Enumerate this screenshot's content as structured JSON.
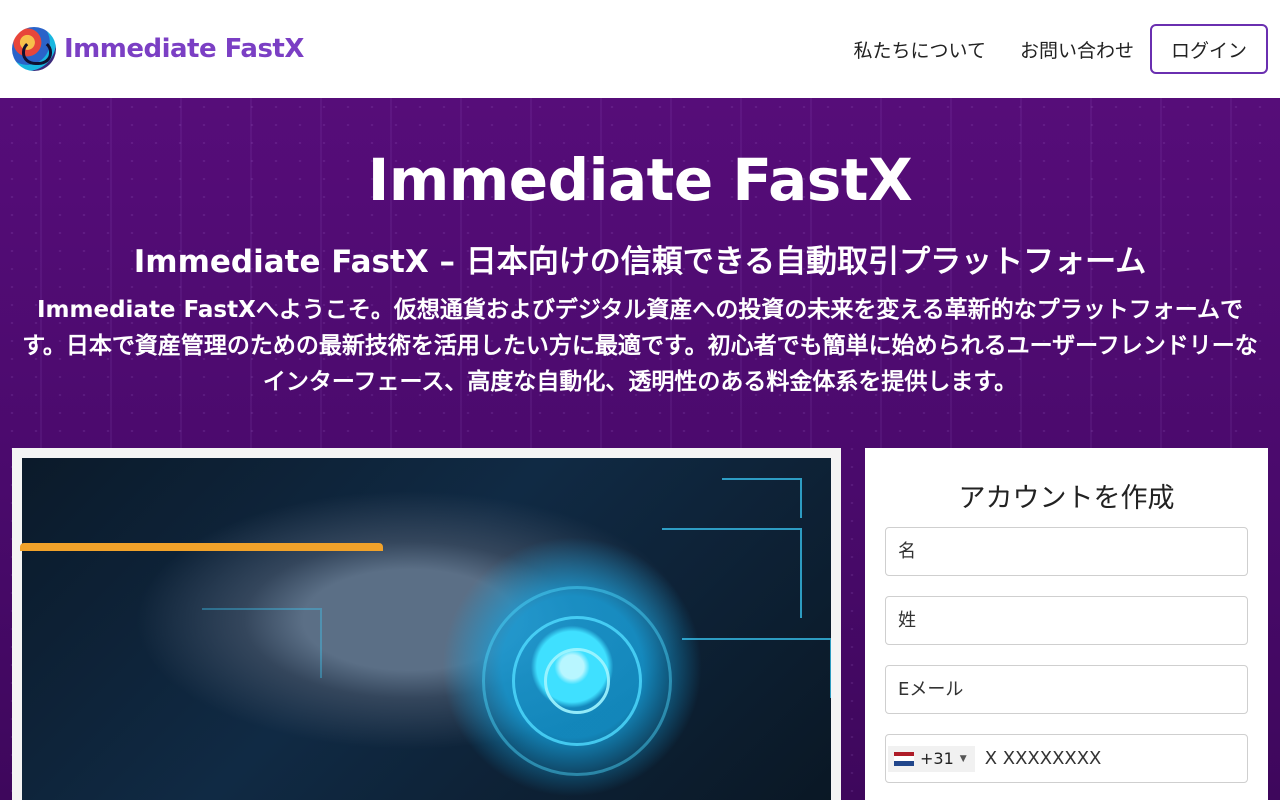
{
  "header": {
    "brand": "Immediate FastX",
    "nav": {
      "about": "私たちについて",
      "contact": "お問い合わせ",
      "login": "ログイン"
    }
  },
  "hero": {
    "title": "Immediate FastX",
    "subtitle": "Immediate FastX – 日本向けの信頼できる自動取引プラットフォーム",
    "description": "Immediate FastXへようこそ。仮想通貨およびデジタル資産への投資の未来を変える革新的なプラットフォームです。日本で資産管理のための最新技術を活用したい方に最適です。初心者でも簡単に始められるユーザーフレンドリーなインターフェース、高度な自動化、透明性のある料金体系を提供します。"
  },
  "form": {
    "title": "アカウントを作成",
    "first_name_placeholder": "名",
    "last_name_placeholder": "姓",
    "email_placeholder": "Eメール",
    "dial_code": "+31",
    "phone_placeholder": "X XXXXXXXX"
  },
  "colors": {
    "brand": "#7b3fc4",
    "hero_bg": "#520c74",
    "login_border": "#6a2fb0",
    "submit": "#f1a22a"
  }
}
